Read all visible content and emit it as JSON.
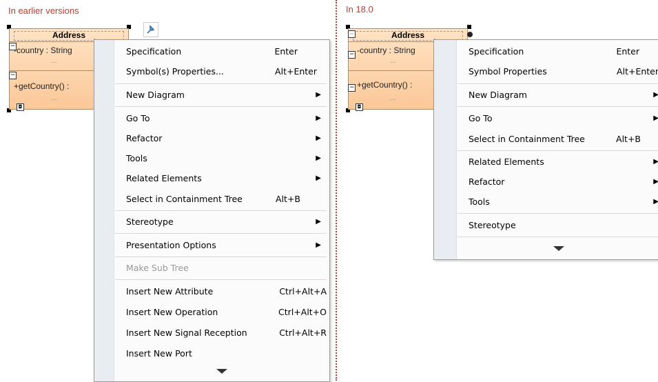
{
  "left_caption": "In earlier versions",
  "right_caption": "In 18.0",
  "class_box": {
    "name": "Address",
    "attribute": "-country : String",
    "operation": "+getCountry() :",
    "dots": "..."
  },
  "right_class_box": {
    "attribute": "-country : String"
  },
  "left_menu": {
    "items": [
      {
        "label": "Specification",
        "shortcut": "Enter"
      },
      {
        "label": "Symbol(s) Properties...",
        "shortcut": "Alt+Enter"
      },
      {
        "label": "New Diagram"
      },
      {
        "label": "Go To"
      },
      {
        "label": "Refactor"
      },
      {
        "label": "Tools"
      },
      {
        "label": "Related Elements"
      },
      {
        "label": "Select in Containment Tree",
        "shortcut": "Alt+B"
      },
      {
        "label": "Stereotype"
      },
      {
        "label": "Presentation Options"
      },
      {
        "label": "Make Sub Tree"
      },
      {
        "label": "Insert New Attribute",
        "shortcut": "Ctrl+Alt+A"
      },
      {
        "label": "Insert New Operation",
        "shortcut": "Ctrl+Alt+O"
      },
      {
        "label": "Insert New Signal Reception",
        "shortcut": "Ctrl+Alt+R"
      },
      {
        "label": "Insert New Port"
      }
    ]
  },
  "right_menu": {
    "items": [
      {
        "label": "Specification",
        "shortcut": "Enter"
      },
      {
        "label": "Symbol Properties",
        "shortcut": "Alt+Enter"
      },
      {
        "label": "New Diagram"
      },
      {
        "label": "Go To"
      },
      {
        "label": "Select in Containment Tree",
        "shortcut": "Alt+B"
      },
      {
        "label": "Related Elements"
      },
      {
        "label": "Refactor"
      },
      {
        "label": "Tools"
      },
      {
        "label": "Stereotype"
      }
    ]
  },
  "colors": {
    "caption": "#c0392b",
    "class_fill_top": "#ffe3c4",
    "class_fill_bottom": "#fbc898",
    "menu_gutter": "#e9edf1"
  }
}
